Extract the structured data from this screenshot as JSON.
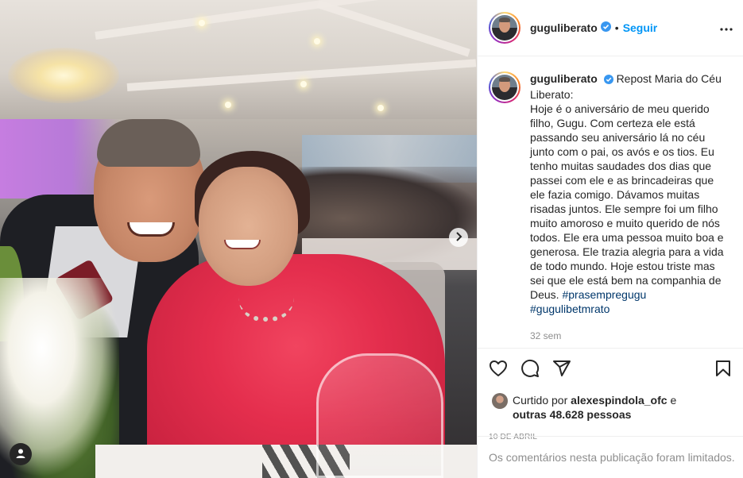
{
  "post": {
    "username": "guguliberato",
    "follow_label": "Seguir",
    "separator": "•",
    "caption_lead": "Repost Maria do Céu Liberato:",
    "caption_body": "Hoje é o aniversário de meu querido filho, Gugu. Com certeza ele está passando seu aniversário lá no céu junto com o pai, os avós e os tios. Eu tenho muitas saudades dos dias que passei com ele e as brincadeiras que ele fazia comigo. Dávamos muitas risadas juntos. Ele sempre foi um filho muito amoroso e muito querido de nós todos. Ele era uma pessoa muito boa e generosa. Ele trazia alegria para a vida de todo mundo. Hoje estou triste mas sei que ele está bem na companhia de Deus.",
    "hashtags": [
      "#prasempregugu",
      "#gugulibetmrato"
    ],
    "time_ago": "32 sem",
    "likes_prefix": "Curtido por",
    "liked_by": "alexespindola_ofc",
    "likes_joiner": "e",
    "likes_others": "outras 48.628 pessoas",
    "date": "10 DE ABRIL",
    "comments_limited": "Os comentários nesta publicação foram limitados."
  },
  "icons": {
    "verified": "verified-badge-icon",
    "more": "more-options-icon",
    "like": "heart-icon",
    "comment": "comment-icon",
    "share": "paper-plane-icon",
    "save": "bookmark-icon",
    "next": "chevron-right-icon",
    "tag": "user-tag-icon"
  },
  "colors": {
    "link_blue": "#0095f6",
    "hashtag": "#00376b",
    "muted": "#8e8e8e",
    "text": "#262626",
    "dress": "#e42e4d"
  }
}
